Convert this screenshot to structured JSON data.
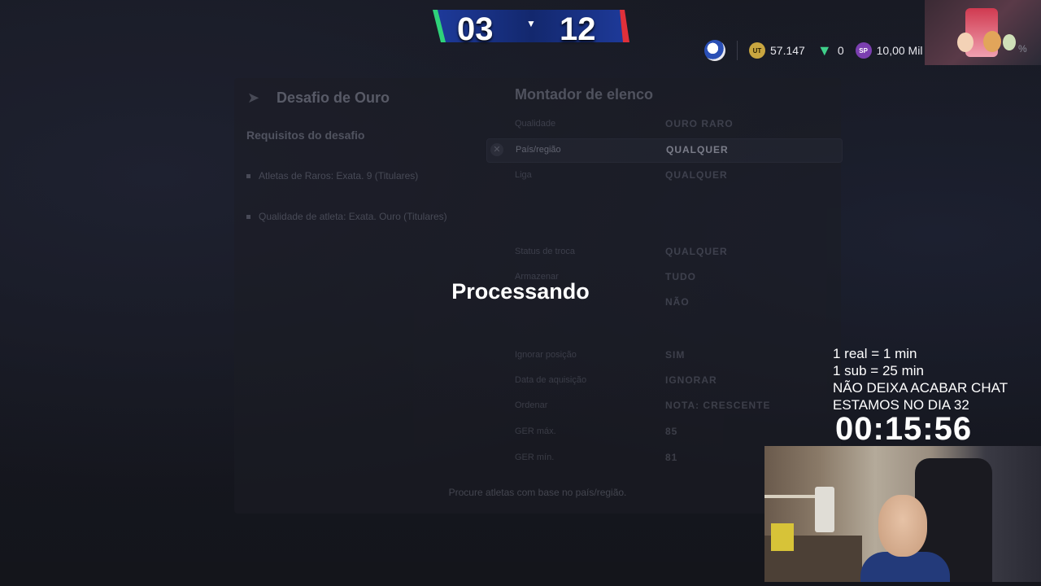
{
  "scoreboard": {
    "home_score": "03",
    "away_score": "12"
  },
  "currency": {
    "coins_icon": "ut-coin-icon",
    "coins": "57.147",
    "fifa_points_icon": "fifa-points-icon",
    "fifa_points": "0",
    "sp_icon": "sp-icon",
    "sp_value": "10,00 Mil"
  },
  "panel": {
    "challenge_title": "Desafio de Ouro",
    "requirements_title": "Requisitos do desafio",
    "requirements": [
      "Atletas de Raros: Exata. 9 (Titulares)",
      "Qualidade de atleta: Exata. Ouro (Titulares)"
    ],
    "builder_title": "Montador de elenco",
    "filters": [
      {
        "label": "Qualidade",
        "value": "OURO RARO"
      },
      {
        "label": "País/região",
        "value": "QUALQUER"
      },
      {
        "label": "Liga",
        "value": "QUALQUER"
      },
      {
        "label": "Status de troca",
        "value": "QUALQUER"
      },
      {
        "label": "Armazenar",
        "value": "TUDO"
      },
      {
        "label": "",
        "value": "NÃO"
      },
      {
        "label": "Ignorar posição",
        "value": "SIM"
      },
      {
        "label": "Data de aquisição",
        "value": "IGNORAR"
      },
      {
        "label": "Ordenar",
        "value": "NOTA: CRESCENTE"
      },
      {
        "label": "GER máx.",
        "value": "85"
      },
      {
        "label": "GER mín.",
        "value": "81"
      }
    ],
    "hint": "Procure atletas com base no país/região."
  },
  "processing_text": "Processando",
  "overlay": {
    "line1": "1 real = 1 min",
    "line2": "1 sub = 25 min",
    "line3": "NÃO DEIXA ACABAR CHAT",
    "line4": "ESTAMOS NO DIA 32",
    "timer": "00:15:56"
  },
  "thumbnail": {
    "percent": "%"
  },
  "colors": {
    "accent_gold": "#c9a640",
    "fp_green": "#3fd08a",
    "sp_purple": "#7b3fb0",
    "score_blue": "#1f3fa8"
  }
}
